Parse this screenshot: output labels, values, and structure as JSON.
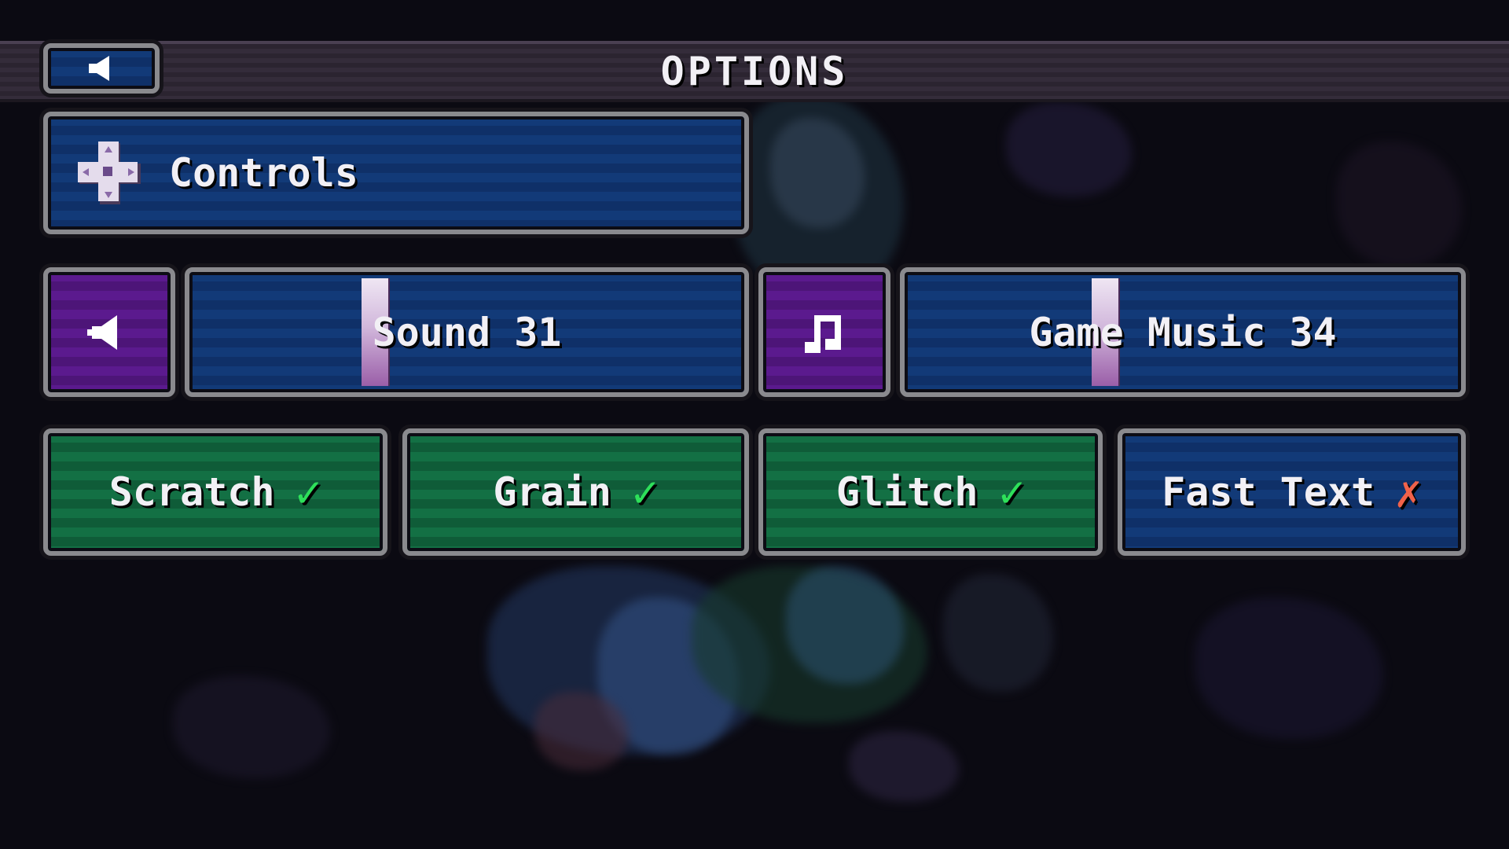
{
  "title": "OPTIONS",
  "back_icon": "speaker-back-icon",
  "controls": {
    "label": "Controls",
    "icon": "dpad-icon"
  },
  "sound": {
    "icon": "speaker-icon",
    "label": "Sound 31",
    "level_percent": 31
  },
  "music": {
    "icon": "music-note-icon",
    "label": "Game Music 34",
    "level_percent": 34
  },
  "toggles": [
    {
      "label": "Scratch",
      "enabled": true,
      "mark": "✓"
    },
    {
      "label": "Grain",
      "enabled": true,
      "mark": "✓"
    },
    {
      "label": "Glitch",
      "enabled": true,
      "mark": "✓"
    },
    {
      "label": "Fast Text",
      "enabled": false,
      "mark": "✗"
    }
  ],
  "colors": {
    "button_blue": "#123a78",
    "button_green": "#137044",
    "button_purple": "#5b1a8e",
    "check_green": "#2ee05a",
    "cross_red": "#f0624a"
  }
}
